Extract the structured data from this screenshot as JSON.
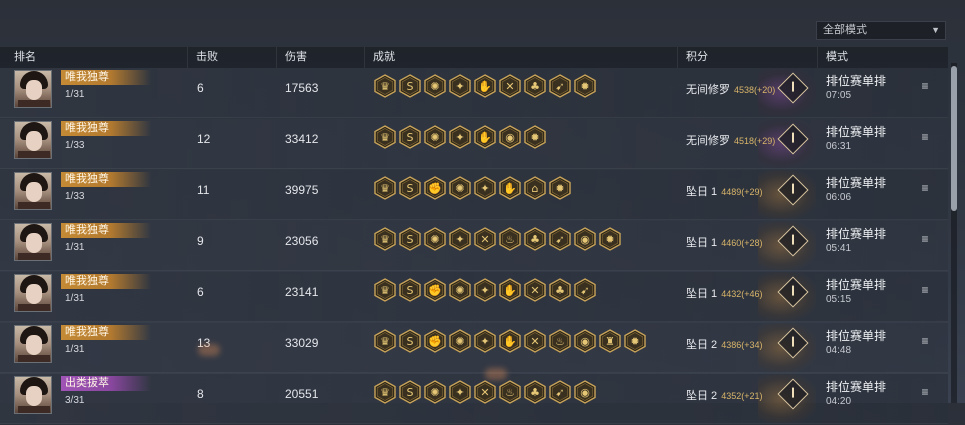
{
  "mode_filter": {
    "selected": "全部模式"
  },
  "headers": {
    "rank": "排名",
    "kills": "击败",
    "damage": "伤害",
    "achievements": "成就",
    "score": "积分",
    "mode": "模式"
  },
  "rows": [
    {
      "title": "唯我独尊",
      "title_color": "#c48a35",
      "rank_sub": "1/31",
      "kills": "6",
      "damage": "17563",
      "achievements": [
        "crown-icon",
        "s-icon",
        "swirl-icon",
        "sp-icon",
        "hand-icon",
        "crossed-swords-icon",
        "clover-icon",
        "boot-icon",
        "gear-icon"
      ],
      "tier": "无间修罗",
      "points": "4538(+20)",
      "mode": "排位赛单排",
      "time": "07:05"
    },
    {
      "title": "唯我独尊",
      "title_color": "#c48a35",
      "rank_sub": "1/33",
      "kills": "12",
      "damage": "33412",
      "achievements": [
        "crown-icon",
        "s-icon",
        "swirl-icon",
        "sp-icon",
        "hand-icon",
        "coin-icon",
        "gear-icon"
      ],
      "tier": "无间修罗",
      "points": "4518(+29)",
      "mode": "排位赛单排",
      "time": "06:31"
    },
    {
      "title": "唯我独尊",
      "title_color": "#c48a35",
      "rank_sub": "1/33",
      "kills": "11",
      "damage": "39975",
      "achievements": [
        "crown-icon",
        "s-icon",
        "fist-icon",
        "swirl-icon",
        "sp-icon",
        "hand-icon",
        "bank-icon",
        "gear-icon"
      ],
      "tier": "坠日 1",
      "points": "4489(+29)",
      "mode": "排位赛单排",
      "time": "06:06"
    },
    {
      "title": "唯我独尊",
      "title_color": "#c48a35",
      "rank_sub": "1/31",
      "kills": "9",
      "damage": "23056",
      "achievements": [
        "crown-icon",
        "s-icon",
        "swirl-icon",
        "sp-icon",
        "crossed-swords-icon",
        "fire-icon",
        "clover-icon",
        "boot-icon",
        "coin-icon",
        "gear-icon"
      ],
      "tier": "坠日 1",
      "points": "4460(+28)",
      "mode": "排位赛单排",
      "time": "05:41"
    },
    {
      "title": "唯我独尊",
      "title_color": "#c48a35",
      "rank_sub": "1/31",
      "kills": "6",
      "damage": "23141",
      "achievements": [
        "crown-icon",
        "s-icon",
        "fist-icon",
        "swirl-icon",
        "sp-icon",
        "hand-icon",
        "crossed-swords-icon",
        "clover-icon",
        "boot-icon"
      ],
      "tier": "坠日 1",
      "points": "4432(+46)",
      "mode": "排位赛单排",
      "time": "05:15"
    },
    {
      "title": "唯我独尊",
      "title_color": "#c48a35",
      "rank_sub": "1/31",
      "kills": "13",
      "damage": "33029",
      "achievements": [
        "crown-icon",
        "s-icon",
        "fist-icon",
        "swirl-icon",
        "sp-icon",
        "hand-icon",
        "crossed-swords-icon",
        "fire-icon",
        "coin-icon",
        "tower-icon",
        "gear-icon"
      ],
      "tier": "坠日 2",
      "points": "4386(+34)",
      "mode": "排位赛单排",
      "time": "04:48"
    },
    {
      "title": "出类拔萃",
      "title_color": "#a054b6",
      "rank_sub": "3/31",
      "kills": "8",
      "damage": "20551",
      "achievements": [
        "crown-icon",
        "s-icon",
        "swirl-icon",
        "sp-icon",
        "crossed-swords-icon",
        "fire-icon",
        "clover-icon",
        "boot-icon",
        "coin-icon"
      ],
      "tier": "坠日 2",
      "points": "4352(+21)",
      "mode": "排位赛单排",
      "time": "04:20"
    }
  ]
}
